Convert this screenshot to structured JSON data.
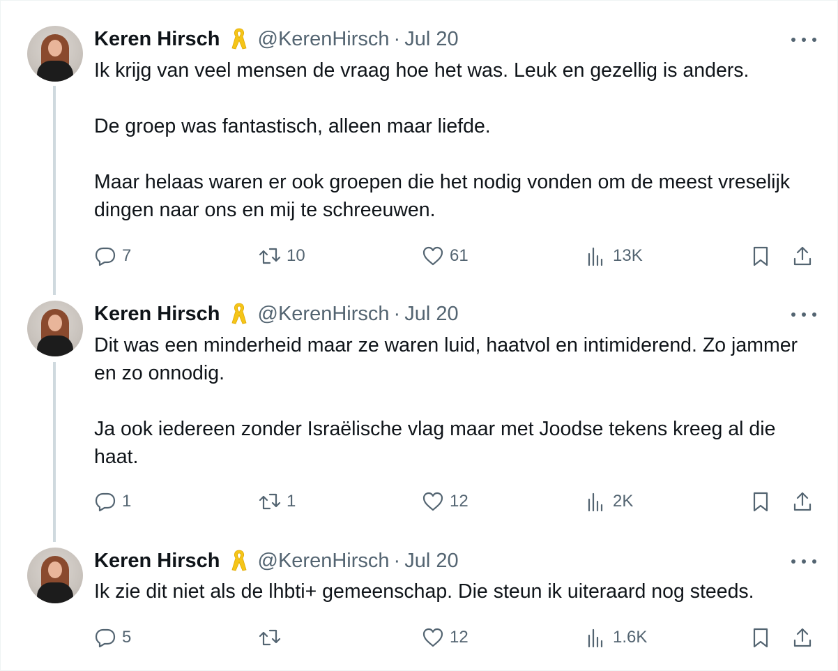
{
  "tweets": [
    {
      "name": "Keren Hirsch",
      "handle": "@KerenHirsch",
      "separator": "·",
      "date": "Jul 20",
      "paragraphs": [
        "Ik krijg van veel mensen de vraag hoe het was. Leuk en gezellig is anders.",
        "De groep was fantastisch, alleen maar liefde.",
        "Maar helaas waren er ook groepen die het nodig vonden om de meest vreselijk dingen naar ons en mij te schreeuwen."
      ],
      "replies": "7",
      "reposts": "10",
      "likes": "61",
      "views": "13K"
    },
    {
      "name": "Keren Hirsch",
      "handle": "@KerenHirsch",
      "separator": "·",
      "date": "Jul 20",
      "paragraphs": [
        "Dit was een minderheid maar ze waren luid, haatvol en intimiderend. Zo jammer en zo onnodig.",
        "Ja ook iedereen zonder Israëlische vlag maar met Joodse tekens kreeg al die haat."
      ],
      "replies": "1",
      "reposts": "1",
      "likes": "12",
      "views": "2K"
    },
    {
      "name": "Keren Hirsch",
      "handle": "@KerenHirsch",
      "separator": "·",
      "date": "Jul 20",
      "paragraphs": [
        "Ik zie dit niet als de lhbti+ gemeenschap. Die steun ik uiteraard nog steeds."
      ],
      "replies": "5",
      "reposts": "",
      "likes": "12",
      "views": "1.6K"
    }
  ],
  "icons": {
    "reply": "reply-icon",
    "repost": "repost-icon",
    "like": "like-icon",
    "views": "views-icon",
    "bookmark": "bookmark-icon",
    "share": "share-icon",
    "ribbon": "yellow-ribbon-icon",
    "more": "more-icon"
  },
  "colors": {
    "text": "#0f1419",
    "secondary": "#536471",
    "thread_line": "#cfd9de",
    "ribbon": "#f5c518"
  }
}
